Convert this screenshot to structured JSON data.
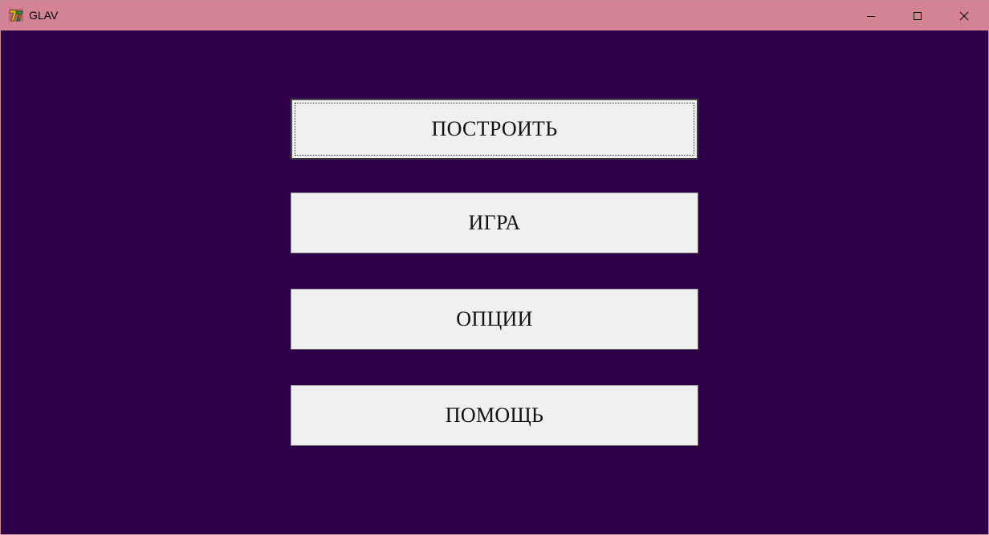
{
  "window": {
    "title": "GLAV",
    "icons": {
      "app": "app-icon",
      "minimize": "minimize-icon",
      "maximize": "maximize-icon",
      "close": "close-icon"
    }
  },
  "menu": {
    "buttons": [
      {
        "label": "ПОСТРОИТЬ",
        "focused": true
      },
      {
        "label": "ИГРА"
      },
      {
        "label": "ОПЦИИ"
      },
      {
        "label": "ПОМОЩЬ"
      }
    ]
  },
  "colors": {
    "titlebar": "#d48296",
    "background": "#2d0048",
    "button_face": "#f0f0f0"
  }
}
